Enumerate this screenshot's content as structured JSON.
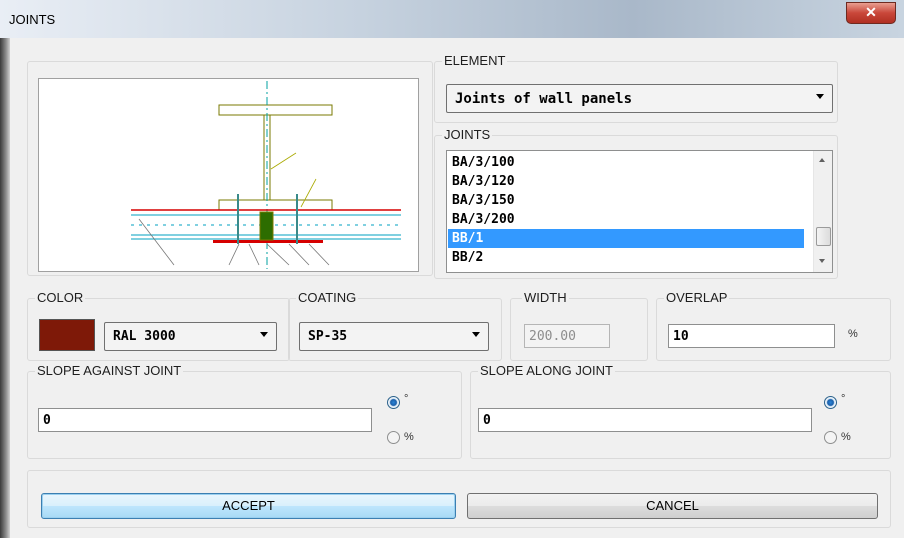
{
  "window": {
    "title": "JOINTS",
    "close_glyph": "✕"
  },
  "element": {
    "label": "ELEMENT",
    "value": "Joints of wall panels"
  },
  "joints": {
    "label": "JOINTS",
    "items": [
      "BA/3/100",
      "BA/3/120",
      "BA/3/150",
      "BA/3/200",
      "BB/1",
      "BB/2"
    ],
    "selected_index": 4
  },
  "color": {
    "label": "COLOR",
    "swatch_hex": "#7e1908",
    "value": "RAL 3000"
  },
  "coating": {
    "label": "COATING",
    "value": "SP-35"
  },
  "width": {
    "label": "WIDTH",
    "value": "200.00"
  },
  "overlap": {
    "label": "OVERLAP",
    "value": "10",
    "unit": "%"
  },
  "slope_against": {
    "label": "SLOPE AGAINST JOINT",
    "value": "0",
    "unit_degree": "°",
    "unit_percent": "%",
    "selected_unit": "degree"
  },
  "slope_along": {
    "label": "SLOPE ALONG JOINT",
    "value": "0",
    "unit_degree": "°",
    "unit_percent": "%",
    "selected_unit": "degree"
  },
  "buttons": {
    "accept": "ACCEPT",
    "cancel": "CANCEL"
  },
  "icons": {
    "close": "close-icon",
    "dropdown": "chevron-down-icon",
    "scroll_up": "scroll-up-icon",
    "scroll_down": "scroll-down-icon"
  }
}
